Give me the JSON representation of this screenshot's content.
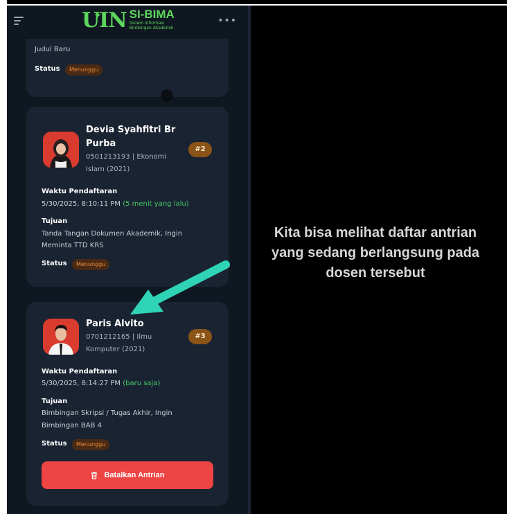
{
  "header": {
    "logo_mark": "UIN",
    "logo_title": "SI-BIMA",
    "logo_subtitle_1": "Sistem Informasi",
    "logo_subtitle_2": "Bimbingan Akademik",
    "menu_icon": "hamburger-icon",
    "more_icon": "more-horizontal-icon"
  },
  "card_prev": {
    "title_tail": "Judul Baru",
    "status_label": "Status",
    "status_value": "Menunggu"
  },
  "queue": [
    {
      "name_line1": "Devia Syahfitri Br",
      "name_line2": "Purba",
      "nim_line1": "0501213193 | Ekonomi",
      "nim_line2": "Islam (2021)",
      "position": "#2",
      "waktu_label": "Waktu Pendaftaran",
      "waktu_value": "5/30/2025, 8:10:11 PM",
      "waktu_relative": "(5 menit yang lalu)",
      "tujuan_label": "Tujuan",
      "tujuan_line1": "Tanda Tangan Dokumen Akademik, Ingin",
      "tujuan_line2": "Meminta TTD KRS",
      "status_label": "Status",
      "status_value": "Menunggu"
    },
    {
      "name_line1": "Paris Alvito",
      "nim_line1": "0701212165 | Ilmu",
      "nim_line2": "Komputer (2021)",
      "position": "#3",
      "waktu_label": "Waktu Pendaftaran",
      "waktu_value": "5/30/2025, 8:14:27 PM",
      "waktu_relative": "(baru saja)",
      "tujuan_label": "Tujuan",
      "tujuan_line1": "Bimbingan Skripsi / Tugas Akhir, Ingin",
      "tujuan_line2": "Bimbingan BAB 4",
      "status_label": "Status",
      "status_value": "Menunggu",
      "cancel_label": "Batalkan Antrian"
    }
  ],
  "overlay": {
    "line1": "Kita bisa melihat daftar antrian",
    "line2": "yang sedang berlangsung pada",
    "line3": "dosen tersebut"
  },
  "colors": {
    "background": "#0f1720",
    "card": "#1a2332",
    "accent_green": "#44c767",
    "status_orange": "#f08c3a",
    "danger": "#ef4444",
    "arrow": "#2fd3b5"
  }
}
